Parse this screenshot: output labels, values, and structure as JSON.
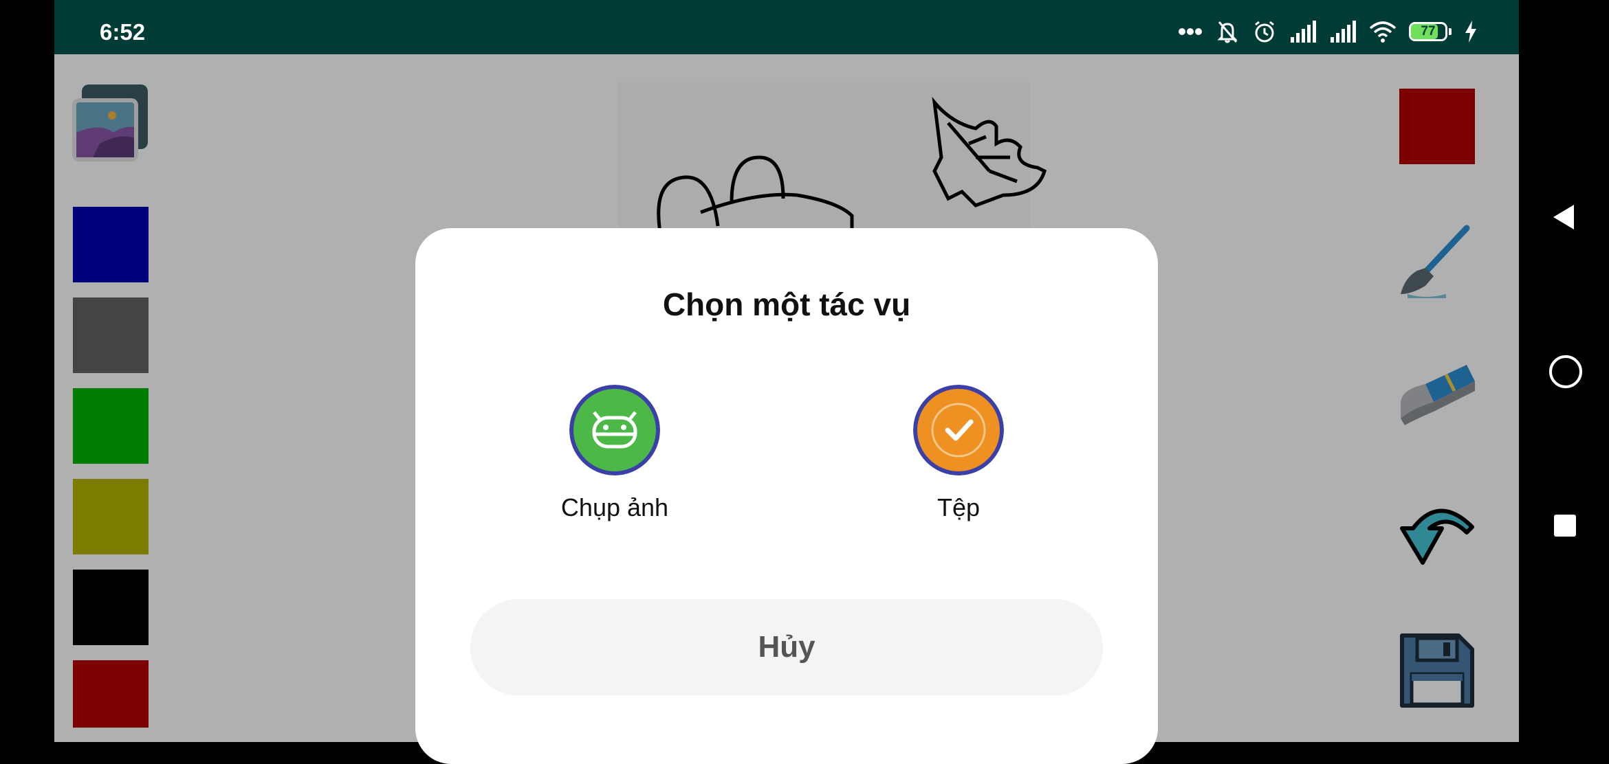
{
  "status_bar": {
    "time": "6:52",
    "battery_level": "77",
    "icons": [
      "more-dots-icon",
      "bell-off-icon",
      "alarm-icon",
      "signal-icon",
      "signal-icon",
      "wifi-icon",
      "battery-icon",
      "charging-icon"
    ]
  },
  "left_palette": {
    "gallery_icon": "gallery-icon",
    "colors": [
      "#0000b4",
      "#636363",
      "#00b400",
      "#b4b400",
      "#000000",
      "#b40000"
    ]
  },
  "right_toolbar": {
    "current_color": "#b40000",
    "tools": [
      "brush-icon",
      "eraser-icon",
      "undo-icon",
      "save-icon"
    ]
  },
  "dialog": {
    "title": "Chọn một tác vụ",
    "options": [
      {
        "label": "Chụp ảnh",
        "icon": "android-camera-icon",
        "color": "#4cb848"
      },
      {
        "label": "Tệp",
        "icon": "file-check-icon",
        "color": "#ee9022"
      }
    ],
    "cancel_label": "Hủy"
  },
  "nav_bar": {
    "buttons": [
      "back-icon",
      "home-icon",
      "recents-icon"
    ]
  }
}
